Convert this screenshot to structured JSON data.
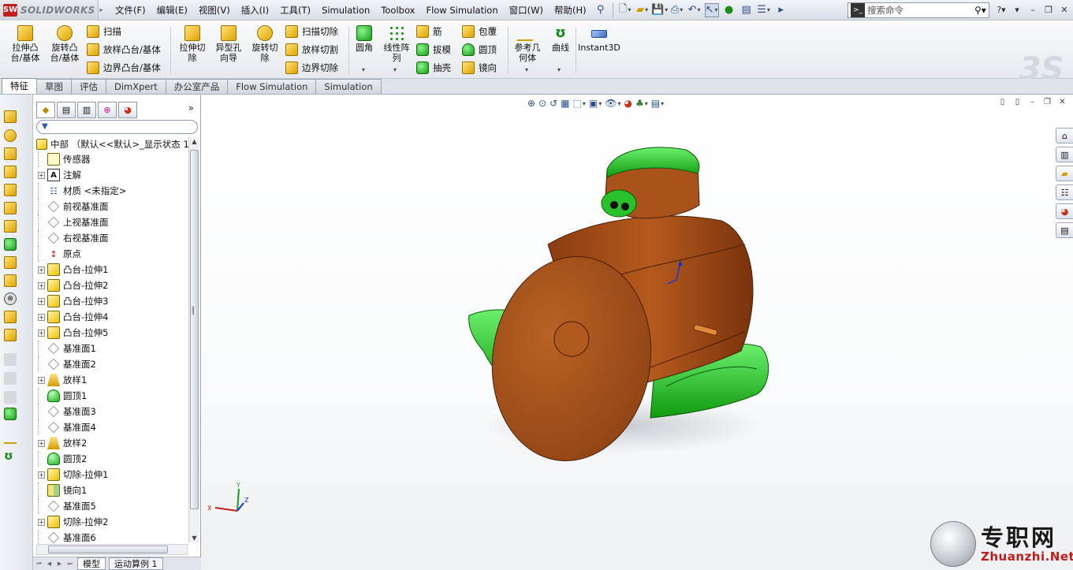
{
  "app": {
    "logo_text": "SOLIDWORKS",
    "logo_mark": "SW"
  },
  "menubar": {
    "items": [
      "文件(F)",
      "编辑(E)",
      "视图(V)",
      "插入(I)",
      "工具(T)",
      "Simulation",
      "Toolbox",
      "Flow Simulation",
      "窗口(W)",
      "帮助(H)"
    ]
  },
  "search": {
    "placeholder": "搜索命令"
  },
  "commands": {
    "extrude_boss": "拉伸凸\n台/基体",
    "revolve_boss": "旋转凸\n台/基体",
    "sweep": "扫描",
    "loft_boss": "放样凸台/基体",
    "boundary_boss": "边界凸台/基体",
    "extrude_cut": "拉伸切\n除",
    "hole_wizard": "异型孔\n向导",
    "revolve_cut": "旋转切\n除",
    "swept_cut": "扫描切除",
    "lofted_cut": "放样切割",
    "boundary_cut": "边界切除",
    "fillet": "圆角",
    "linear_pattern": "线性阵\n列",
    "rib": "筋",
    "draft": "拔模",
    "shell": "抽壳",
    "wrap": "包覆",
    "dome": "圆顶",
    "mirror": "镜向",
    "ref_geometry": "参考几\n何体",
    "curves": "曲线",
    "instant3d": "Instant3D"
  },
  "tabs": [
    "特征",
    "草图",
    "评估",
    "DimXpert",
    "办公室产品",
    "Flow Simulation",
    "Simulation"
  ],
  "active_tab": "特征",
  "tree": {
    "root": "中部 （默认<<默认>_显示状态 1",
    "items": [
      {
        "label": "传感器",
        "icon": "sensor-icon",
        "expandable": false
      },
      {
        "label": "注解",
        "icon": "annotation-icon",
        "expandable": true
      },
      {
        "label": "材质 <未指定>",
        "icon": "material-icon",
        "expandable": false
      },
      {
        "label": "前视基准面",
        "icon": "plane-icon",
        "expandable": false
      },
      {
        "label": "上视基准面",
        "icon": "plane-icon",
        "expandable": false
      },
      {
        "label": "右视基准面",
        "icon": "plane-icon",
        "expandable": false
      },
      {
        "label": "原点",
        "icon": "origin-icon",
        "expandable": false
      },
      {
        "label": "凸台-拉伸1",
        "icon": "boss-extrude-icon",
        "expandable": true
      },
      {
        "label": "凸台-拉伸2",
        "icon": "boss-extrude-icon",
        "expandable": true
      },
      {
        "label": "凸台-拉伸3",
        "icon": "boss-extrude-icon",
        "expandable": true
      },
      {
        "label": "凸台-拉伸4",
        "icon": "boss-extrude-icon",
        "expandable": true
      },
      {
        "label": "凸台-拉伸5",
        "icon": "boss-extrude-icon",
        "expandable": true
      },
      {
        "label": "基准面1",
        "icon": "plane-icon",
        "expandable": false
      },
      {
        "label": "基准面2",
        "icon": "plane-icon",
        "expandable": false
      },
      {
        "label": "放样1",
        "icon": "loft-icon",
        "expandable": true
      },
      {
        "label": "圆顶1",
        "icon": "dome-icon",
        "expandable": false
      },
      {
        "label": "基准面3",
        "icon": "plane-icon",
        "expandable": false
      },
      {
        "label": "基准面4",
        "icon": "plane-icon",
        "expandable": false
      },
      {
        "label": "放样2",
        "icon": "loft-icon",
        "expandable": true
      },
      {
        "label": "圆顶2",
        "icon": "dome-icon",
        "expandable": false
      },
      {
        "label": "切除-拉伸1",
        "icon": "cut-extrude-icon",
        "expandable": true
      },
      {
        "label": "镜向1",
        "icon": "mirror-icon",
        "expandable": false
      },
      {
        "label": "基准面5",
        "icon": "plane-icon",
        "expandable": false
      },
      {
        "label": "切除-拉伸2",
        "icon": "cut-extrude-icon",
        "expandable": true
      },
      {
        "label": "基准面6",
        "icon": "plane-icon",
        "expandable": false
      }
    ]
  },
  "bottom_tabs": [
    "模型",
    "运动算例 1"
  ],
  "triad": {
    "x": "X",
    "y": "Y",
    "z": "Z"
  },
  "watermark": {
    "cn": "专职网",
    "en": "Zhuanzhi.Net"
  },
  "colors": {
    "body": "#b4541a",
    "accent_green": "#1fb81f",
    "brand_red": "#c11d17"
  }
}
